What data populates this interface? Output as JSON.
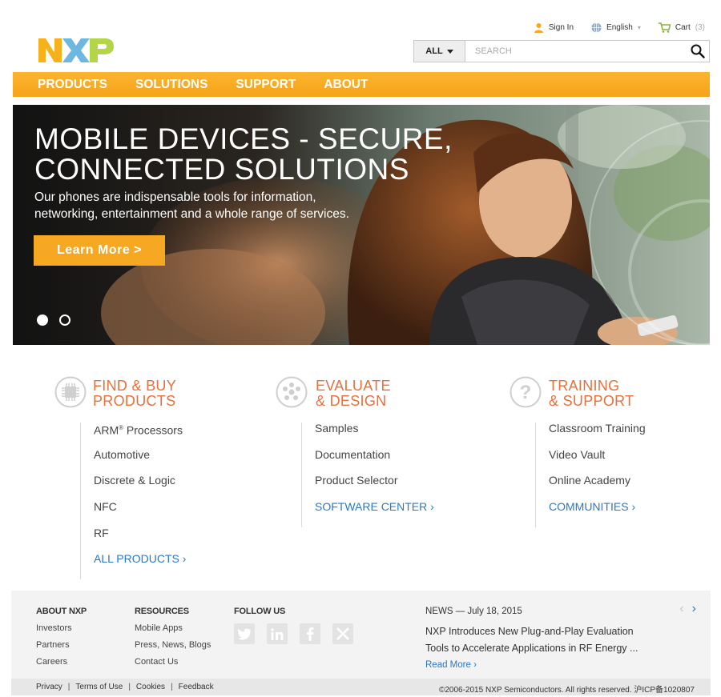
{
  "utility": {
    "signin": "Sign In",
    "language": "English",
    "cart": "Cart",
    "cart_count": "(3)"
  },
  "brand": {
    "logo_text": "NXP",
    "colors": {
      "orange": "#f7a823",
      "blue": "#6eb7e1",
      "green": "#b4d44a",
      "heading": "#e8703a",
      "link": "#2a78c7"
    }
  },
  "search": {
    "category": "ALL",
    "placeholder": "SEARCH"
  },
  "nav": {
    "items": [
      "PRODUCTS",
      "SOLUTIONS",
      "SUPPORT",
      "ABOUT"
    ]
  },
  "hero": {
    "title_line1": "MOBILE DEVICES - SECURE,",
    "title_line2": "CONNECTED SOLUTIONS",
    "description": "Our phones are indispensable tools for information, networking, entertainment and a whole range of services.",
    "button": "Learn More  >",
    "slides": 2,
    "active_slide": 1
  },
  "columns": [
    {
      "icon": "chip-icon",
      "heading_line1": "FIND & BUY",
      "heading_line2": "PRODUCTS",
      "links": [
        "ARM",
        "Automotive",
        "Discrete & Logic",
        "NFC",
        "RF"
      ],
      "arm_suffix": " Processors",
      "arm_mark": "®",
      "more": "ALL PRODUCTS ›"
    },
    {
      "icon": "molecule-icon",
      "heading_line1": "EVALUATE",
      "heading_line2": "& DESIGN",
      "links": [
        "Samples",
        "Documentation",
        "Product Selector"
      ],
      "more": "SOFTWARE CENTER ›"
    },
    {
      "icon": "question-icon",
      "heading_line1": "TRAINING",
      "heading_line2": "& SUPPORT",
      "links": [
        "Classroom Training",
        "Video Vault",
        "Online Academy"
      ],
      "more": "COMMUNITIES ›"
    }
  ],
  "footer": {
    "about": {
      "heading": "ABOUT NXP",
      "links": [
        "Investors",
        "Partners",
        "Careers"
      ]
    },
    "resources": {
      "heading": "RESOURCES",
      "links": [
        "Mobile Apps",
        "Press, News, Blogs",
        "Contact Us"
      ]
    },
    "follow": {
      "heading": "FOLLOW US",
      "icons": [
        "twitter-icon",
        "linkedin-icon",
        "facebook-icon",
        "xing-icon"
      ]
    },
    "news": {
      "heading": "NEWS — July 18, 2015",
      "text": "NXP Introduces New Plug-and-Play Evaluation Tools to Accelerate Applications in RF Energy ...",
      "more": "Read More ›",
      "prev": "‹",
      "next": "›"
    }
  },
  "bottom": {
    "links": [
      "Privacy",
      "Terms of Use",
      "Cookies",
      "Feedback"
    ],
    "copyright": "©2006-2015 NXP Semiconductors. All rights reserved. 沪ICP备1020807"
  }
}
